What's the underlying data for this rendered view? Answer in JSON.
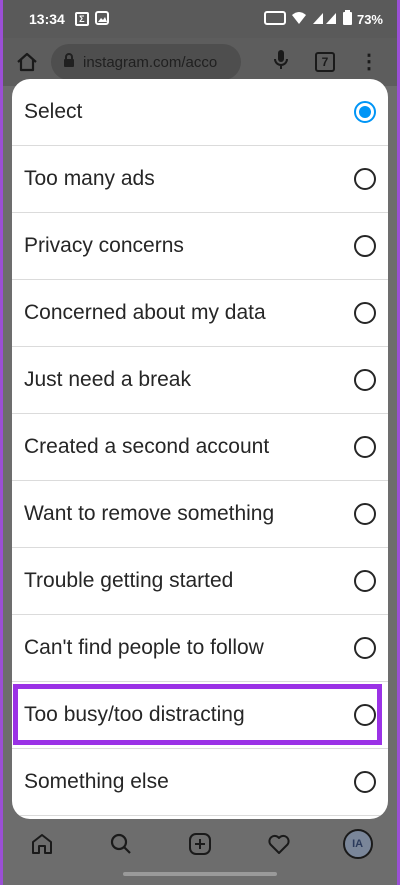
{
  "status_bar": {
    "time": "13:34",
    "battery": "73%"
  },
  "browser": {
    "url": "instagram.com/acco",
    "tab_count": "7"
  },
  "dialog": {
    "options": [
      {
        "label": "Select",
        "selected": true
      },
      {
        "label": "Too many ads",
        "selected": false
      },
      {
        "label": "Privacy concerns",
        "selected": false
      },
      {
        "label": "Concerned about my data",
        "selected": false
      },
      {
        "label": "Just need a break",
        "selected": false
      },
      {
        "label": "Created a second account",
        "selected": false
      },
      {
        "label": "Want to remove something",
        "selected": false
      },
      {
        "label": "Trouble getting started",
        "selected": false
      },
      {
        "label": "Can't find people to follow",
        "selected": false
      },
      {
        "label": "Too busy/too distracting",
        "selected": false,
        "highlighted": true
      },
      {
        "label": "Something else",
        "selected": false
      }
    ]
  },
  "bottom_nav": {
    "avatar_initials": "IA"
  },
  "colors": {
    "accent": "#0095f6",
    "highlight": "#9b32e6",
    "overlay": "#6d6d6d"
  },
  "icons": [
    "home-icon",
    "lock-icon",
    "mic-icon",
    "tabs-icon",
    "menu-icon",
    "search-icon",
    "add-post-icon",
    "heart-icon",
    "profile-avatar"
  ]
}
